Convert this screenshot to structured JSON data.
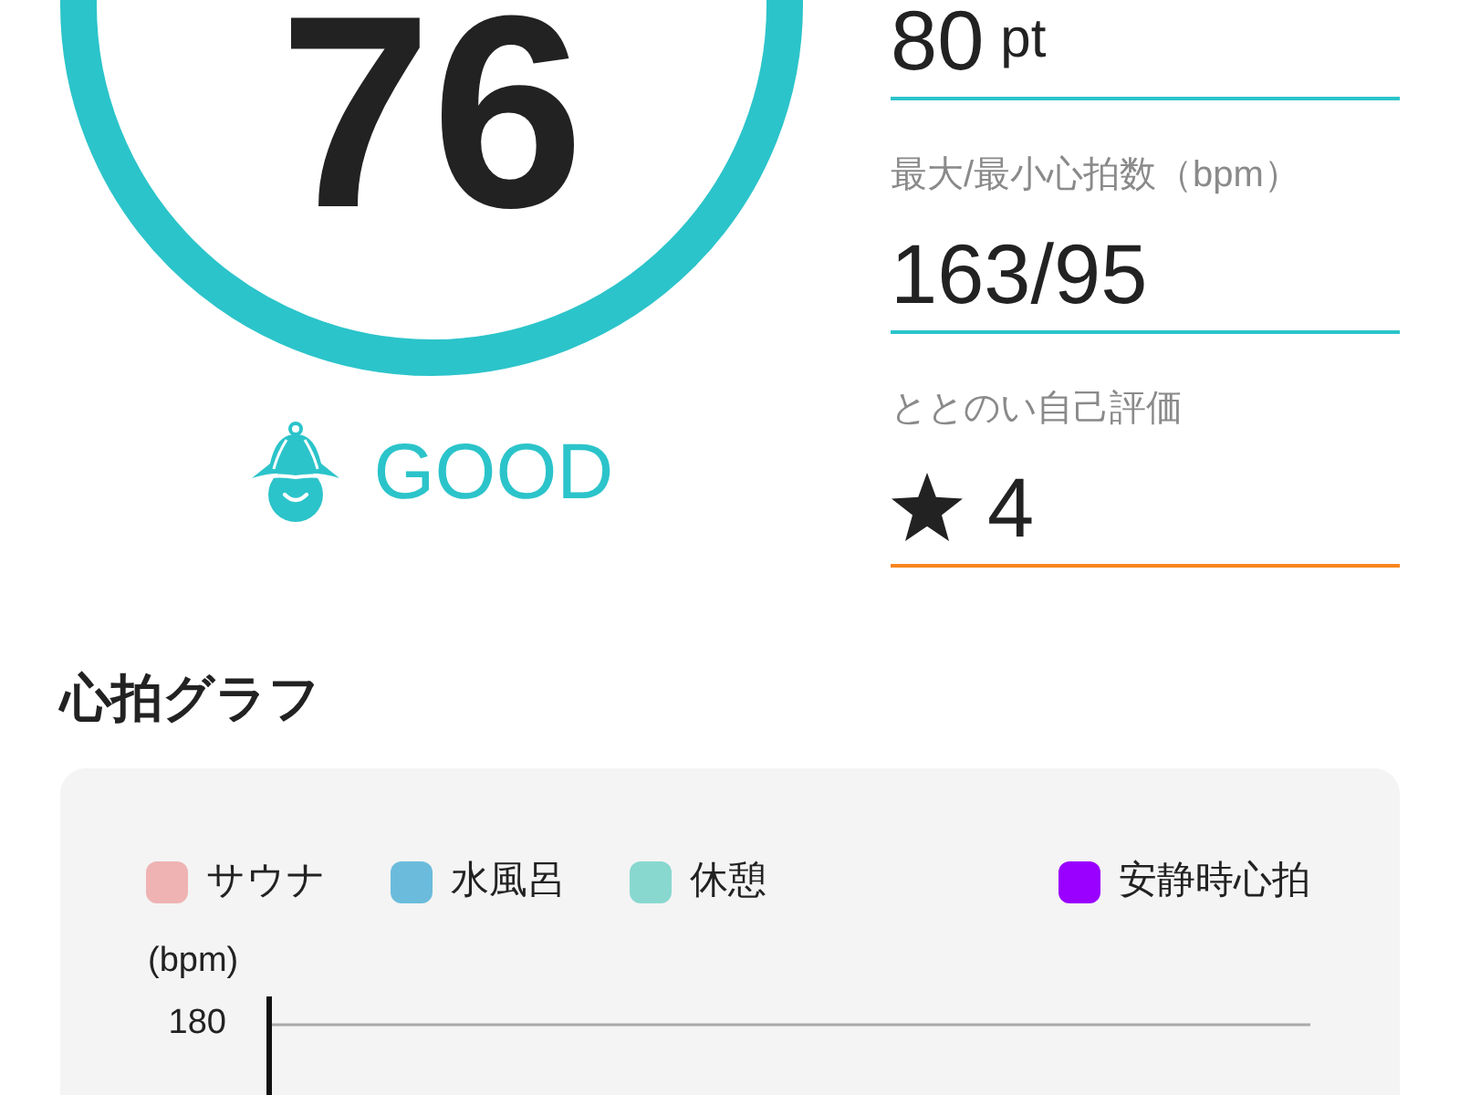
{
  "score": {
    "value": "76",
    "status": "GOOD"
  },
  "metrics": [
    {
      "kind": "number",
      "value": "80",
      "unit": "pt",
      "color": "#2bc4ca"
    },
    {
      "kind": "number",
      "label": "最大/最小心拍数（bpm）",
      "value": "163/95",
      "color": "#2bc4ca"
    },
    {
      "kind": "rating",
      "label": "ととのい自己評価",
      "value": "4",
      "color": "#f7861f"
    }
  ],
  "heart_rate_graph": {
    "title": "心拍グラフ",
    "legend": [
      {
        "kind": "zone",
        "label": "サウナ",
        "color": "#efb3b3"
      },
      {
        "kind": "zone",
        "label": "水風呂",
        "color": "#6bbcdc"
      },
      {
        "kind": "zone",
        "label": "休憩",
        "color": "#88d8cf"
      },
      {
        "kind": "line",
        "label": "安静時心拍",
        "color": "#9900ff"
      }
    ],
    "y_unit": "(bpm)",
    "y_tick_labels": [
      "180"
    ]
  }
}
